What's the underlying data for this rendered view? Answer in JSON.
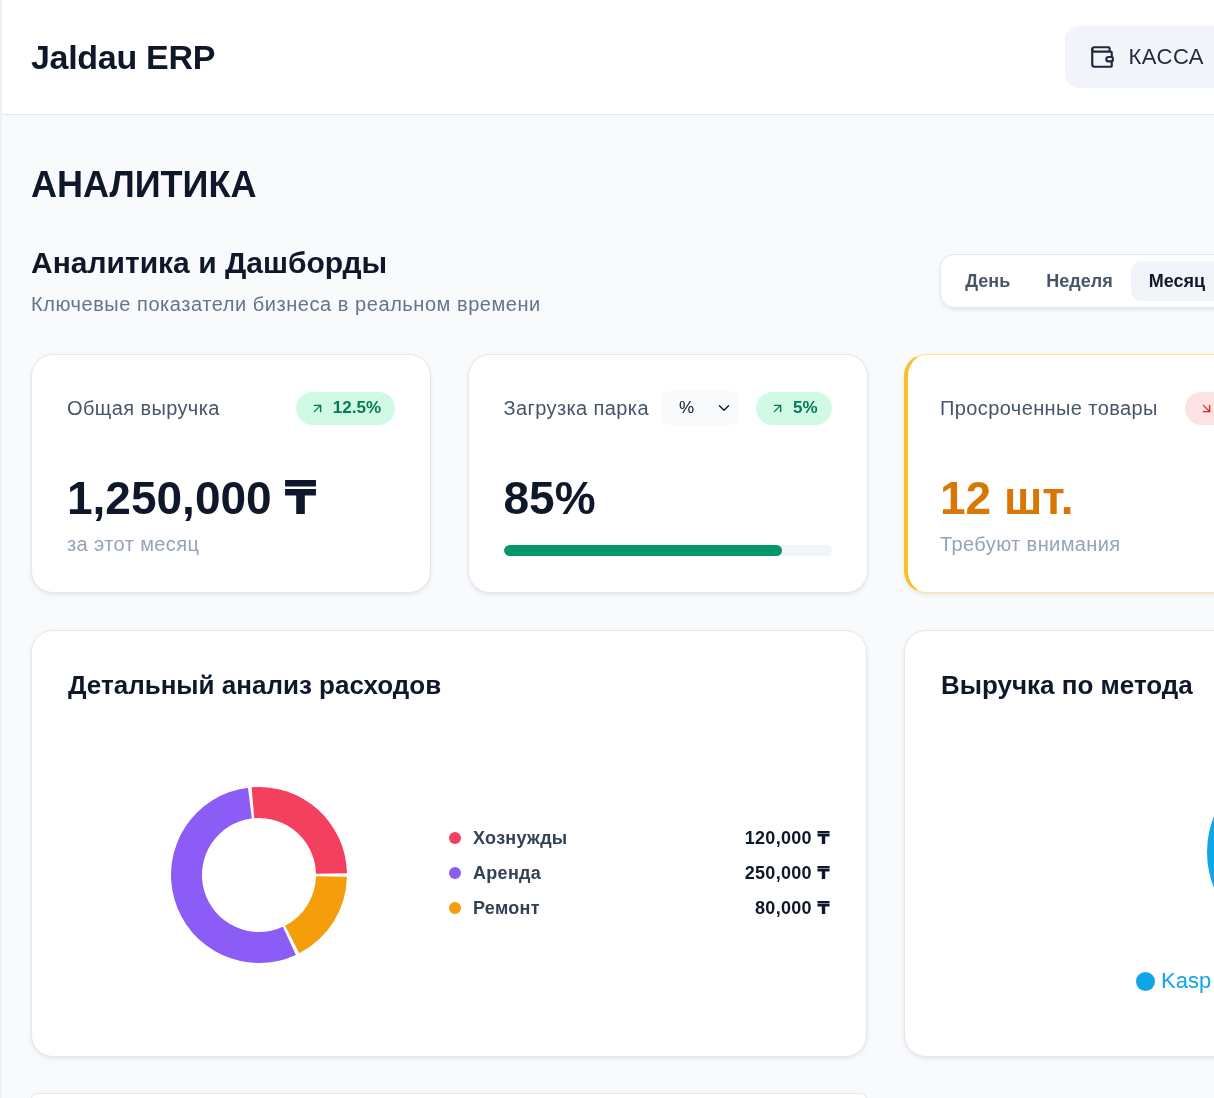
{
  "header": {
    "title": "Jaldau ERP",
    "cash_button": "КАССА"
  },
  "page_title": "АНАЛИТИКА",
  "section": {
    "title": "Аналитика и Дашборды",
    "subtitle": "Ключевые показатели бизнеса в реальном времени",
    "periods": [
      {
        "label": "День",
        "selected": false
      },
      {
        "label": "Неделя",
        "selected": false
      },
      {
        "label": "Месяц",
        "selected": true
      }
    ]
  },
  "stats": [
    {
      "kind": "total",
      "label": "Общая выручка",
      "badge": {
        "negative": false,
        "text": "12.5%"
      },
      "value": "1,250,000 ₸",
      "note": "за этот месяц"
    },
    {
      "kind": "progress",
      "label": "Загрузка парка",
      "unit_select": "%",
      "badge": {
        "negative": false,
        "text": "5%"
      },
      "value": "85%",
      "level": 0.85
    },
    {
      "kind": "alert",
      "label": "Просроченные товары",
      "badge": {
        "negative": true
      },
      "value": "12 шт.",
      "note": "Требуют внимания"
    }
  ],
  "panels": [
    {
      "kind": "breakdown",
      "title": "Детальный анализ расходов",
      "chart_data": {
        "type": "donut",
        "categories": [
          "Хознужды",
          "Аренда",
          "Ремонт"
        ],
        "values": [
          120000,
          250000,
          80000
        ],
        "value_labels": [
          "120,000 ₸",
          "250,000 ₸",
          "80,000 ₸"
        ],
        "colors": [
          "#f43f5e",
          "#8b5cf6",
          "#f59e0b"
        ],
        "legend": "right"
      }
    },
    {
      "kind": "methods",
      "title": "Выручка по метода",
      "legend": [
        {
          "label": "Kasp",
          "color": "#0ea5e9"
        }
      ]
    }
  ]
}
